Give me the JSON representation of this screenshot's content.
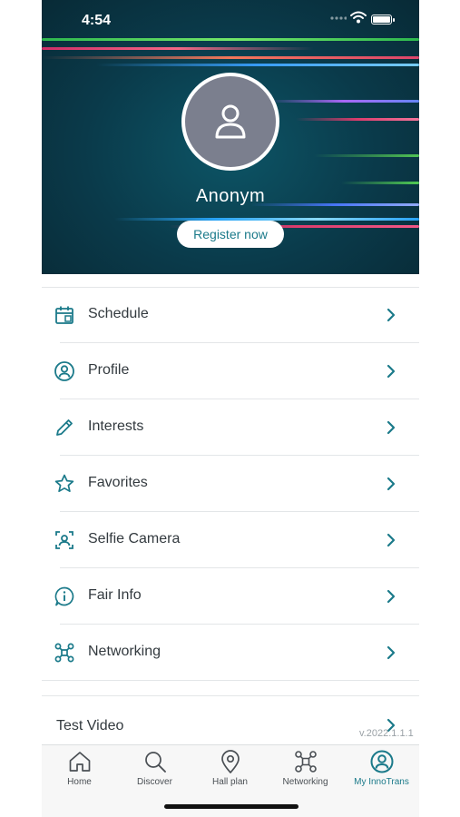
{
  "status_bar": {
    "time": "4:54"
  },
  "profile": {
    "name": "Anonym",
    "register_label": "Register now"
  },
  "menu": {
    "items": [
      {
        "label": "Schedule",
        "icon": "calendar-icon"
      },
      {
        "label": "Profile",
        "icon": "user-circle-icon"
      },
      {
        "label": "Interests",
        "icon": "pencil-icon"
      },
      {
        "label": "Favorites",
        "icon": "star-icon"
      },
      {
        "label": "Selfie Camera",
        "icon": "selfie-camera-icon"
      },
      {
        "label": "Fair Info",
        "icon": "info-icon"
      },
      {
        "label": "Networking",
        "icon": "network-icon"
      }
    ],
    "test_video": "Test Video",
    "version": "v.2022.1.1.1"
  },
  "tabbar": {
    "tabs": [
      {
        "label": "Home",
        "icon": "home-icon"
      },
      {
        "label": "Discover",
        "icon": "search-icon"
      },
      {
        "label": "Hall plan",
        "icon": "location-pin-icon"
      },
      {
        "label": "Networking",
        "icon": "network-icon"
      },
      {
        "label": "My InnoTrans",
        "icon": "user-circle-icon",
        "active": true
      }
    ]
  },
  "colors": {
    "accent": "#1b7a8a",
    "header_bg": "#0a3a4a",
    "avatar_bg": "#7b7f8e"
  }
}
